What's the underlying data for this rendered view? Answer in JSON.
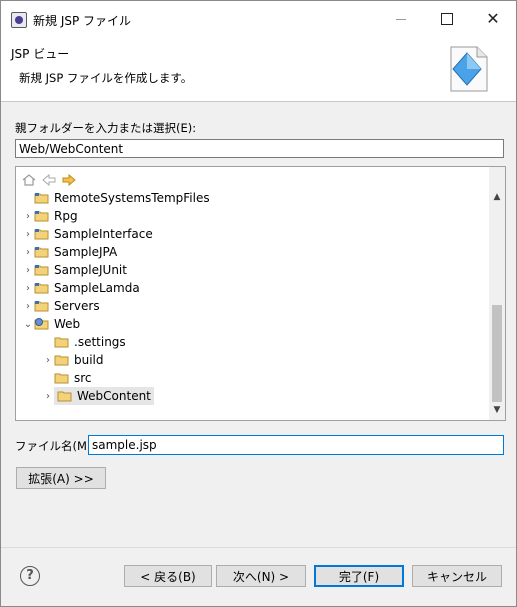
{
  "window": {
    "title": "新規 JSP ファイル",
    "controls": [
      "minimize",
      "maximize",
      "close"
    ]
  },
  "header": {
    "title": "JSP ビュー",
    "description": "新規 JSP ファイルを作成します。"
  },
  "parent_folder": {
    "label": "親フォルダーを入力または選択(E):",
    "value": "Web/WebContent"
  },
  "tree": {
    "items": [
      {
        "label": "RemoteSystemsTempFiles",
        "expandable": false,
        "icon": "project-folder-icon"
      },
      {
        "label": "Rpg",
        "expandable": true,
        "icon": "project-folder-icon"
      },
      {
        "label": "SampleInterface",
        "expandable": true,
        "icon": "project-folder-icon"
      },
      {
        "label": "SampleJPA",
        "expandable": true,
        "icon": "project-folder-icon"
      },
      {
        "label": "SampleJUnit",
        "expandable": true,
        "icon": "project-folder-icon"
      },
      {
        "label": "SampleLamda",
        "expandable": true,
        "icon": "project-folder-icon"
      },
      {
        "label": "Servers",
        "expandable": true,
        "icon": "project-folder-icon"
      },
      {
        "label": "Web",
        "expandable": true,
        "expanded": true,
        "icon": "web-project-icon"
      },
      {
        "label": ".settings",
        "expandable": false,
        "icon": "folder-icon"
      },
      {
        "label": "build",
        "expandable": true,
        "icon": "folder-icon"
      },
      {
        "label": "src",
        "expandable": false,
        "icon": "folder-icon"
      },
      {
        "label": "WebContent",
        "expandable": true,
        "selected": true,
        "icon": "folder-icon"
      }
    ]
  },
  "file_name": {
    "label": "ファイル名(M):",
    "value": "sample.jsp"
  },
  "buttons": {
    "advanced": "拡張(A) >>",
    "back": "< 戻る(B)",
    "next": "次へ(N) >",
    "finish": "完了(F)",
    "cancel": "キャンセル"
  },
  "help_icon": "?"
}
